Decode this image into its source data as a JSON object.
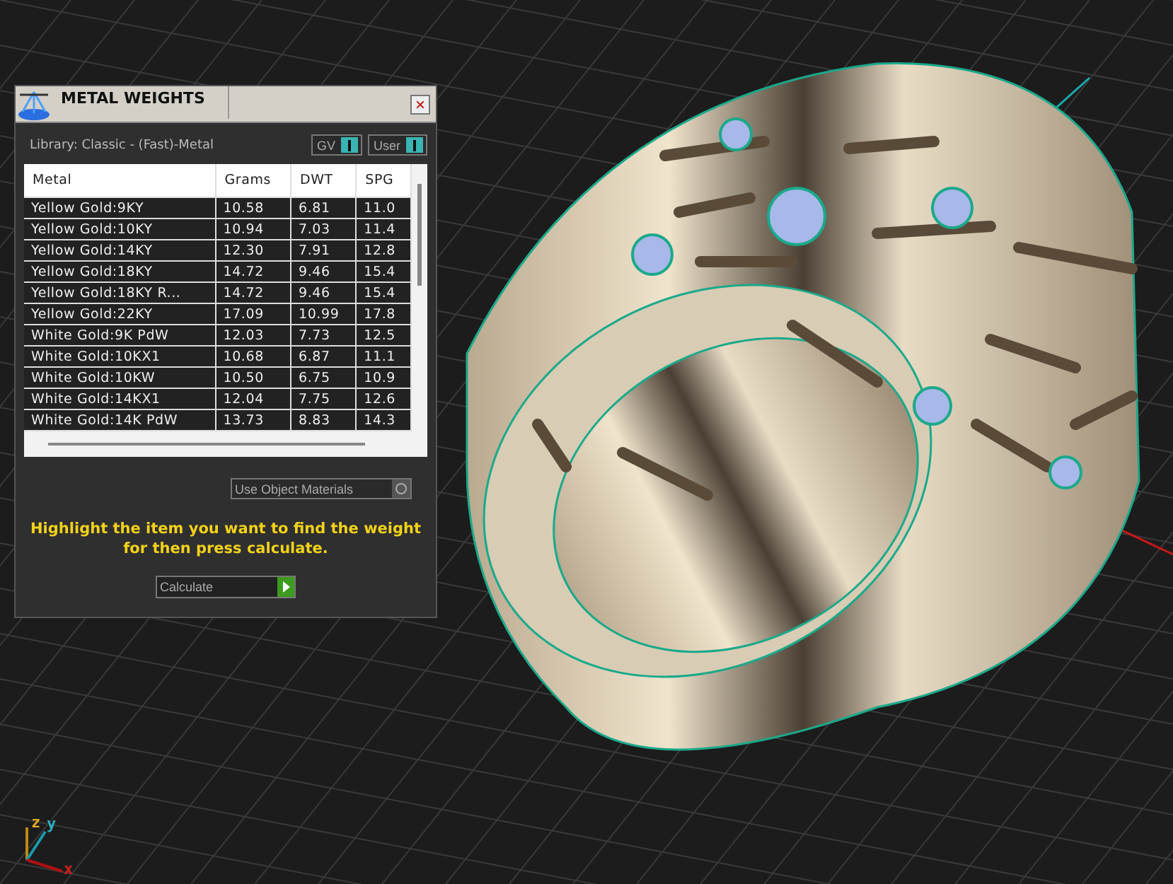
{
  "panel": {
    "title": "METAL WEIGHTS",
    "close": "×",
    "library": "Library: Classic - (Fast)-Metal",
    "toggles": [
      {
        "label": "GV",
        "on": true
      },
      {
        "label": "User",
        "on": true
      }
    ],
    "table": {
      "columns": [
        "Metal",
        "Grams",
        "DWT",
        "SPG"
      ],
      "rows": [
        [
          "Yellow Gold:9KY",
          "10.58",
          "6.81",
          "11.0"
        ],
        [
          "Yellow Gold:10KY",
          "10.94",
          "7.03",
          "11.4"
        ],
        [
          "Yellow Gold:14KY",
          "12.30",
          "7.91",
          "12.8"
        ],
        [
          "Yellow Gold:18KY",
          "14.72",
          "9.46",
          "15.4"
        ],
        [
          "Yellow Gold:18KY R...",
          "14.72",
          "9.46",
          "15.4"
        ],
        [
          "Yellow Gold:22KY",
          "17.09",
          "10.99",
          "17.8"
        ],
        [
          "White Gold:9K PdW",
          "12.03",
          "7.73",
          "12.5"
        ],
        [
          "White Gold:10KX1",
          "10.68",
          "6.87",
          "11.1"
        ],
        [
          "White Gold:10KW",
          "10.50",
          "6.75",
          "10.9"
        ],
        [
          "White Gold:14KX1",
          "12.04",
          "7.75",
          "12.6"
        ],
        [
          "White Gold:14K PdW",
          "13.73",
          "8.83",
          "14.3"
        ]
      ]
    },
    "use_object_materials": "Use Object Materials",
    "hint": "Highlight the item you want to find the weight for then press calculate.",
    "calculate": "Calculate"
  },
  "axes": [
    "z",
    "y",
    "x"
  ]
}
